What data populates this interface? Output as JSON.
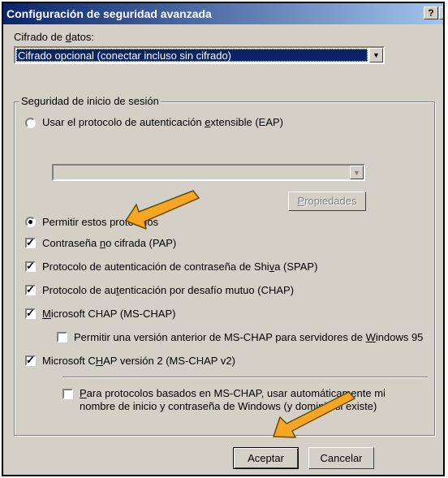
{
  "dialog": {
    "title": "Configuración de seguridad avanzada",
    "help_button": "?",
    "close_button": "×"
  },
  "encryption": {
    "label_pre": "Cifrado de ",
    "label_key": "d",
    "label_post": "atos:",
    "selected_value": "Cifrado opcional (conectar incluso sin cifrado)"
  },
  "logon_security": {
    "group_label": "Seguridad de inicio de sesión",
    "eap_radio": {
      "label_pre": "Usar el protocolo de autenticación ",
      "label_key": "e",
      "label_post": "xtensible (EAP)",
      "selected": false
    },
    "eap_combo_value": "",
    "properties_button": {
      "label_key": "P",
      "label_post": "ropiedades"
    },
    "allow_radio": {
      "label": "Permitir estos protocolos",
      "selected": true
    },
    "protocols": [
      {
        "pre": "Contraseña ",
        "key": "n",
        "post": "o cifrada (PAP)",
        "checked": true
      },
      {
        "pre": "Protocolo de autenticación de contraseña de Shi",
        "key": "v",
        "post": "a (SPAP)",
        "checked": true
      },
      {
        "pre": "Protocolo de au",
        "key": "t",
        "post": "enticación por desafío mutuo (CHAP)",
        "checked": true
      },
      {
        "pre": "",
        "key": "M",
        "post": "icrosoft CHAP (MS-CHAP)",
        "checked": true
      },
      {
        "pre": "Permitir una versión anterior de MS-CHAP para servidores de ",
        "key": "W",
        "post": "indows 95",
        "checked": false
      },
      {
        "pre": "Microsoft C",
        "key": "H",
        "post": "AP versión 2 (MS-CHAP v2)",
        "checked": true
      }
    ],
    "windows_credentials": {
      "line1_pre": "",
      "line1_key": "P",
      "line1_post": "ara protocolos basados en MS-CHAP, usar automáticamente mi",
      "line2": "nombre de inicio y contraseña de Windows (y dominio si existe)",
      "checked": false
    }
  },
  "buttons": {
    "ok": "Aceptar",
    "cancel": "Cancelar"
  },
  "colors": {
    "title_gradient_start": "#0a246a",
    "title_gradient_end": "#a6caf0",
    "dialog_face": "#d4d0c8",
    "selection": "#0a246a",
    "annotation_arrow": "#f5a623"
  }
}
